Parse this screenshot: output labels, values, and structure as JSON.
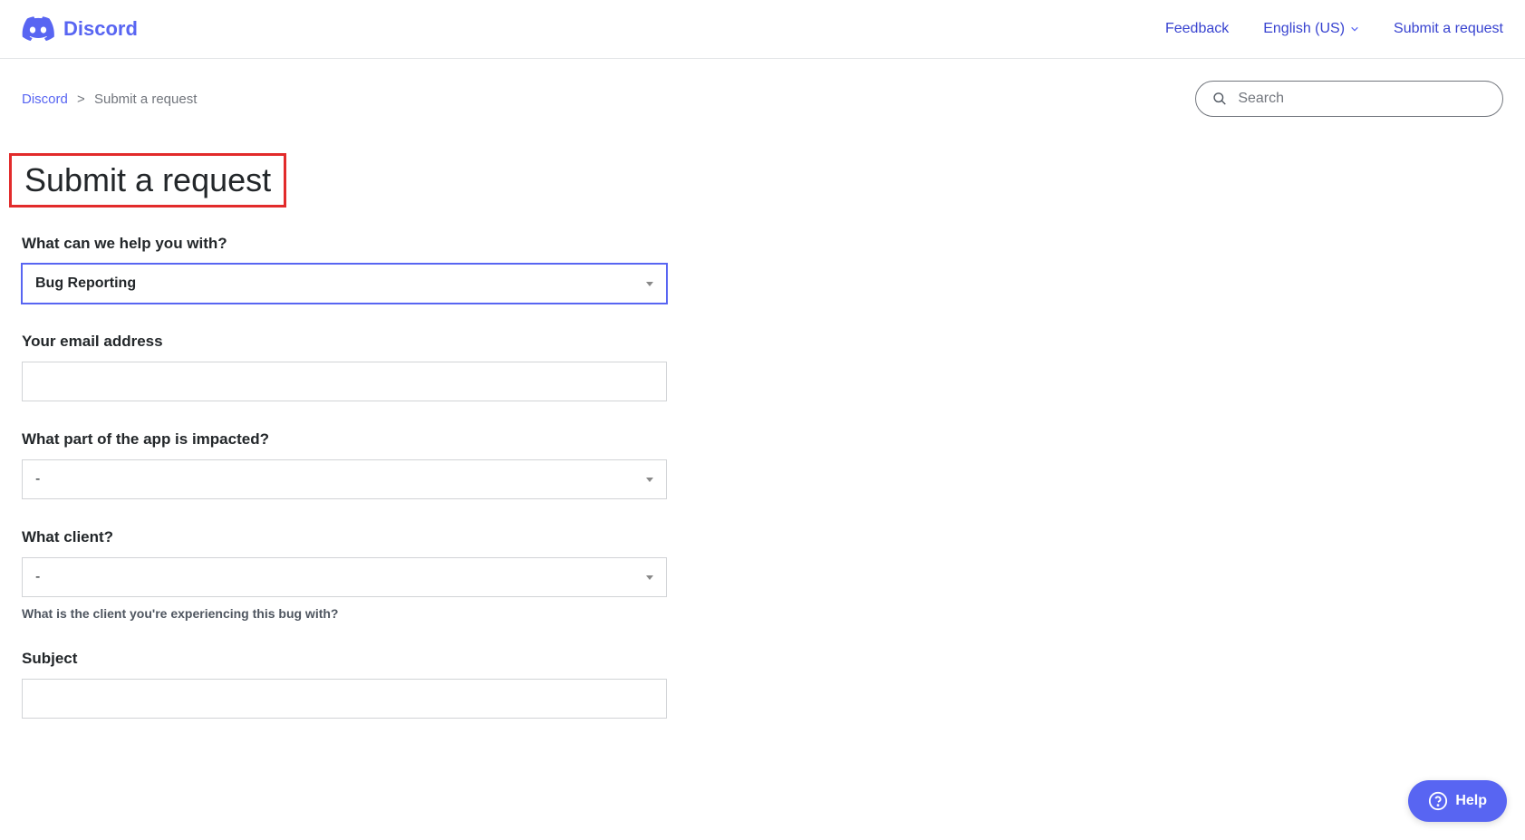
{
  "brand": "Discord",
  "nav": {
    "feedback": "Feedback",
    "language": "English (US)",
    "submit": "Submit a request"
  },
  "breadcrumb": {
    "root": "Discord",
    "current": "Submit a request"
  },
  "search": {
    "placeholder": "Search"
  },
  "page": {
    "title": "Submit a request"
  },
  "form": {
    "help_with": {
      "label": "What can we help you with?",
      "value": "Bug Reporting"
    },
    "email": {
      "label": "Your email address",
      "value": ""
    },
    "app_part": {
      "label": "What part of the app is impacted?",
      "value": "-"
    },
    "client": {
      "label": "What client?",
      "value": "-",
      "hint": "What is the client you're experiencing this bug with?"
    },
    "subject": {
      "label": "Subject",
      "value": ""
    }
  },
  "help_widget": {
    "label": "Help"
  }
}
